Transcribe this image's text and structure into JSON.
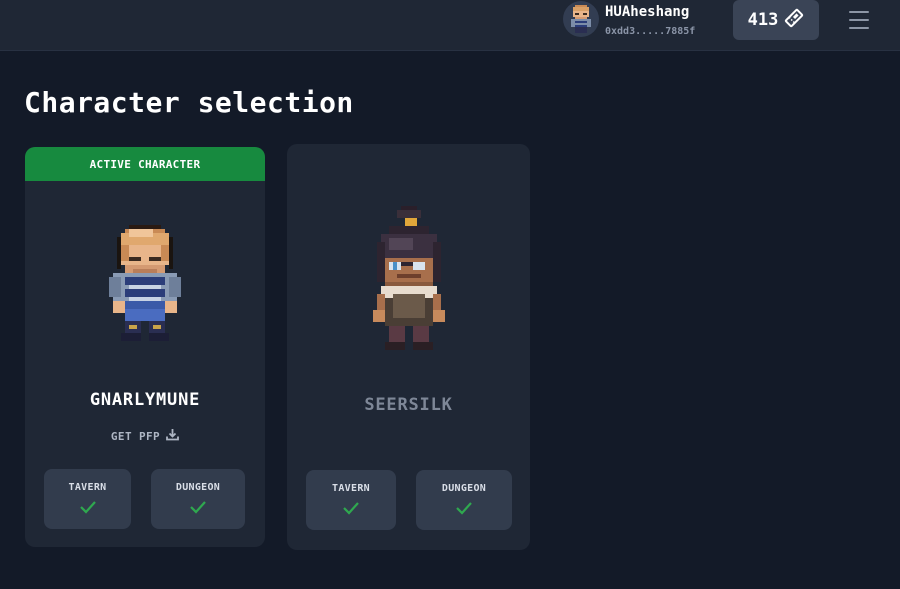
{
  "header": {
    "username": "HUAheshang",
    "address": "0xdd3.....7885f",
    "ticket_count": "413",
    "icons": {
      "ticket": "ticket-icon",
      "menu": "hamburger-menu-icon",
      "avatar": "pixel-character-avatar"
    }
  },
  "page": {
    "title": "Character selection"
  },
  "characters": [
    {
      "name": "GNARLYMUNE",
      "active": true,
      "badge": "ACTIVE CHARACTER",
      "pfp_link": "GET PFP",
      "modes": [
        {
          "label": "TAVERN",
          "status": "check"
        },
        {
          "label": "DUNGEON",
          "status": "check"
        }
      ]
    },
    {
      "name": "SEERSILK",
      "active": false,
      "modes": [
        {
          "label": "TAVERN",
          "status": "check"
        },
        {
          "label": "DUNGEON",
          "status": "check"
        }
      ]
    }
  ],
  "colors": {
    "background": "#131a28",
    "header": "#1f2735",
    "card": "#1f2735",
    "active_green": "#178a3f",
    "check_green": "#2fa84f",
    "mode_tile": "#323c4d"
  }
}
